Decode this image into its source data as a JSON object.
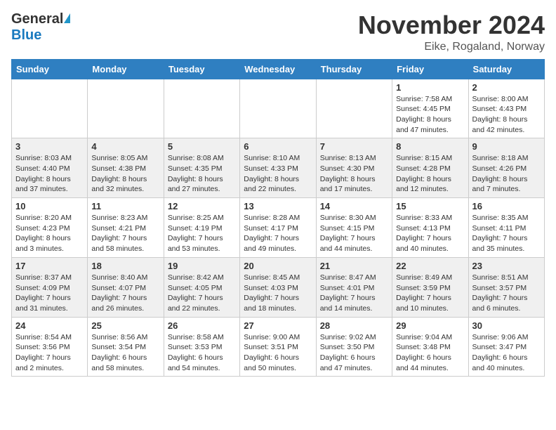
{
  "header": {
    "logo_general": "General",
    "logo_blue": "Blue",
    "month_title": "November 2024",
    "location": "Eike, Rogaland, Norway"
  },
  "calendar": {
    "days_of_week": [
      "Sunday",
      "Monday",
      "Tuesday",
      "Wednesday",
      "Thursday",
      "Friday",
      "Saturday"
    ],
    "weeks": [
      [
        {
          "day": "",
          "info": ""
        },
        {
          "day": "",
          "info": ""
        },
        {
          "day": "",
          "info": ""
        },
        {
          "day": "",
          "info": ""
        },
        {
          "day": "",
          "info": ""
        },
        {
          "day": "1",
          "info": "Sunrise: 7:58 AM\nSunset: 4:45 PM\nDaylight: 8 hours\nand 47 minutes."
        },
        {
          "day": "2",
          "info": "Sunrise: 8:00 AM\nSunset: 4:43 PM\nDaylight: 8 hours\nand 42 minutes."
        }
      ],
      [
        {
          "day": "3",
          "info": "Sunrise: 8:03 AM\nSunset: 4:40 PM\nDaylight: 8 hours\nand 37 minutes."
        },
        {
          "day": "4",
          "info": "Sunrise: 8:05 AM\nSunset: 4:38 PM\nDaylight: 8 hours\nand 32 minutes."
        },
        {
          "day": "5",
          "info": "Sunrise: 8:08 AM\nSunset: 4:35 PM\nDaylight: 8 hours\nand 27 minutes."
        },
        {
          "day": "6",
          "info": "Sunrise: 8:10 AM\nSunset: 4:33 PM\nDaylight: 8 hours\nand 22 minutes."
        },
        {
          "day": "7",
          "info": "Sunrise: 8:13 AM\nSunset: 4:30 PM\nDaylight: 8 hours\nand 17 minutes."
        },
        {
          "day": "8",
          "info": "Sunrise: 8:15 AM\nSunset: 4:28 PM\nDaylight: 8 hours\nand 12 minutes."
        },
        {
          "day": "9",
          "info": "Sunrise: 8:18 AM\nSunset: 4:26 PM\nDaylight: 8 hours\nand 7 minutes."
        }
      ],
      [
        {
          "day": "10",
          "info": "Sunrise: 8:20 AM\nSunset: 4:23 PM\nDaylight: 8 hours\nand 3 minutes."
        },
        {
          "day": "11",
          "info": "Sunrise: 8:23 AM\nSunset: 4:21 PM\nDaylight: 7 hours\nand 58 minutes."
        },
        {
          "day": "12",
          "info": "Sunrise: 8:25 AM\nSunset: 4:19 PM\nDaylight: 7 hours\nand 53 minutes."
        },
        {
          "day": "13",
          "info": "Sunrise: 8:28 AM\nSunset: 4:17 PM\nDaylight: 7 hours\nand 49 minutes."
        },
        {
          "day": "14",
          "info": "Sunrise: 8:30 AM\nSunset: 4:15 PM\nDaylight: 7 hours\nand 44 minutes."
        },
        {
          "day": "15",
          "info": "Sunrise: 8:33 AM\nSunset: 4:13 PM\nDaylight: 7 hours\nand 40 minutes."
        },
        {
          "day": "16",
          "info": "Sunrise: 8:35 AM\nSunset: 4:11 PM\nDaylight: 7 hours\nand 35 minutes."
        }
      ],
      [
        {
          "day": "17",
          "info": "Sunrise: 8:37 AM\nSunset: 4:09 PM\nDaylight: 7 hours\nand 31 minutes."
        },
        {
          "day": "18",
          "info": "Sunrise: 8:40 AM\nSunset: 4:07 PM\nDaylight: 7 hours\nand 26 minutes."
        },
        {
          "day": "19",
          "info": "Sunrise: 8:42 AM\nSunset: 4:05 PM\nDaylight: 7 hours\nand 22 minutes."
        },
        {
          "day": "20",
          "info": "Sunrise: 8:45 AM\nSunset: 4:03 PM\nDaylight: 7 hours\nand 18 minutes."
        },
        {
          "day": "21",
          "info": "Sunrise: 8:47 AM\nSunset: 4:01 PM\nDaylight: 7 hours\nand 14 minutes."
        },
        {
          "day": "22",
          "info": "Sunrise: 8:49 AM\nSunset: 3:59 PM\nDaylight: 7 hours\nand 10 minutes."
        },
        {
          "day": "23",
          "info": "Sunrise: 8:51 AM\nSunset: 3:57 PM\nDaylight: 7 hours\nand 6 minutes."
        }
      ],
      [
        {
          "day": "24",
          "info": "Sunrise: 8:54 AM\nSunset: 3:56 PM\nDaylight: 7 hours\nand 2 minutes."
        },
        {
          "day": "25",
          "info": "Sunrise: 8:56 AM\nSunset: 3:54 PM\nDaylight: 6 hours\nand 58 minutes."
        },
        {
          "day": "26",
          "info": "Sunrise: 8:58 AM\nSunset: 3:53 PM\nDaylight: 6 hours\nand 54 minutes."
        },
        {
          "day": "27",
          "info": "Sunrise: 9:00 AM\nSunset: 3:51 PM\nDaylight: 6 hours\nand 50 minutes."
        },
        {
          "day": "28",
          "info": "Sunrise: 9:02 AM\nSunset: 3:50 PM\nDaylight: 6 hours\nand 47 minutes."
        },
        {
          "day": "29",
          "info": "Sunrise: 9:04 AM\nSunset: 3:48 PM\nDaylight: 6 hours\nand 44 minutes."
        },
        {
          "day": "30",
          "info": "Sunrise: 9:06 AM\nSunset: 3:47 PM\nDaylight: 6 hours\nand 40 minutes."
        }
      ]
    ]
  }
}
